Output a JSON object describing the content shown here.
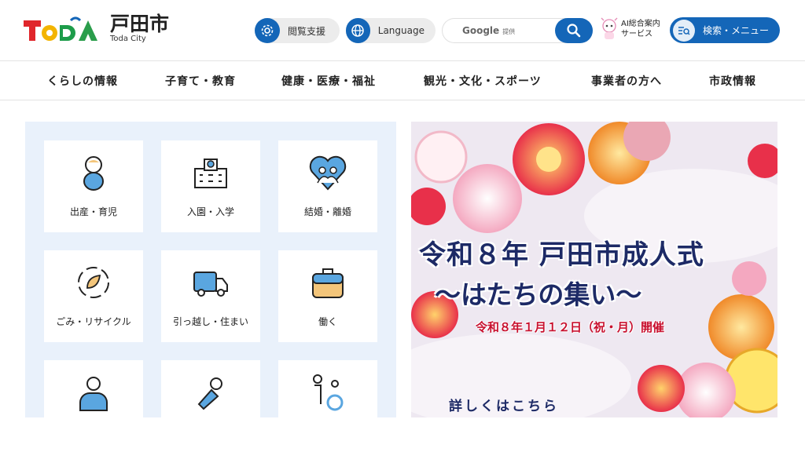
{
  "header": {
    "logo_mark": "TODA",
    "logo_jp": "戸田市",
    "logo_en": "Toda City",
    "reading_support_label": "閲覧支援",
    "language_label": "Language",
    "search_brand": "Google",
    "search_brand_suffix": "提供",
    "ai_line1": "AI総合案内",
    "ai_line2": "サービス",
    "menu_label": "検索・メニュー"
  },
  "nav": {
    "items": [
      {
        "label": "くらしの情報"
      },
      {
        "label": "子育て・教育"
      },
      {
        "label": "健康・医療・福祉"
      },
      {
        "label": "観光・文化・スポーツ"
      },
      {
        "label": "事業者の方へ"
      },
      {
        "label": "市政情報"
      }
    ]
  },
  "tiles": [
    {
      "label": "出産・育児",
      "icon": "baby-icon"
    },
    {
      "label": "入園・入学",
      "icon": "school-icon"
    },
    {
      "label": "結婚・離婚",
      "icon": "heart-couple-icon"
    },
    {
      "label": "ごみ・リサイクル",
      "icon": "recycle-icon"
    },
    {
      "label": "引っ越し・住まい",
      "icon": "moving-truck-icon"
    },
    {
      "label": "働く",
      "icon": "briefcase-icon"
    },
    {
      "label": "",
      "icon": "doctor-icon"
    },
    {
      "label": "",
      "icon": "bouquet-icon"
    },
    {
      "label": "",
      "icon": "wheelchair-icon"
    }
  ],
  "banner": {
    "title": "令和８年 戸田市成人式",
    "subtitle": "〜はたちの集い〜",
    "date": "令和８年１月１２日（祝・月）開催",
    "more_link": "詳しくはこちら"
  },
  "colors": {
    "brand_blue": "#1466b8",
    "panel_bg": "#e9f1fb",
    "banner_navy": "#1d2a66",
    "banner_red": "#c8102e"
  }
}
